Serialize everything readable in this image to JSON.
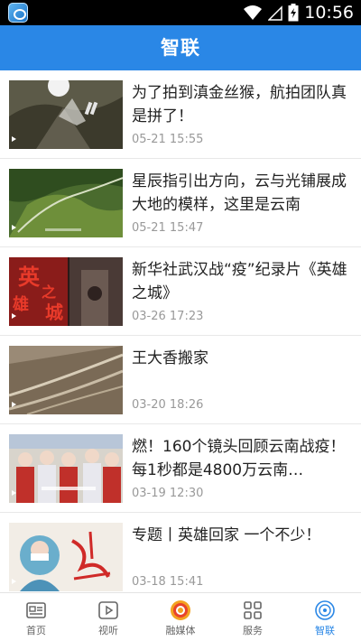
{
  "status_bar": {
    "time": "10:56"
  },
  "header": {
    "title": "智联"
  },
  "news": [
    {
      "title": "为了拍到滇金丝猴，航拍团队真是拼了！",
      "time": "05-21 15:55",
      "thumb_icon": "snow-mountain-drone-photo"
    },
    {
      "title": "星辰指引出方向，云与光铺展成大地的模样，这里是云南",
      "time": "05-21 15:47",
      "thumb_icon": "green-river-valley-photo"
    },
    {
      "title": "新华社武汉战“疫”纪录片《英雄之城》",
      "time": "03-26 17:23",
      "thumb_icon": "heroic-city-calligraphy-poster"
    },
    {
      "title": "王大香搬家",
      "time": "03-20 18:26",
      "thumb_icon": "mountain-road-photo"
    },
    {
      "title": "燃！160个镜头回顾云南战疫！每1秒都是4800万云南…",
      "time": "03-19 12:30",
      "thumb_icon": "medical-team-photo"
    },
    {
      "title": "专题丨英雄回家 一个不少！",
      "time": "03-18 15:41",
      "thumb_icon": "heroes-return-home-poster"
    }
  ],
  "thumb_overlay_texts": [
    "英",
    "雄",
    "之",
    "城"
  ],
  "tabs": [
    {
      "label": "首页",
      "icon": "home-icon",
      "active": false
    },
    {
      "label": "视听",
      "icon": "play-icon",
      "active": false
    },
    {
      "label": "融媒体",
      "icon": "media-logo-icon",
      "active": false
    },
    {
      "label": "服务",
      "icon": "grid-icon",
      "active": false
    },
    {
      "label": "智联",
      "icon": "zhilian-icon",
      "active": true
    }
  ],
  "colors": {
    "primary": "#2a87e6",
    "status_bar": "#000000",
    "time_text": "#999999"
  }
}
